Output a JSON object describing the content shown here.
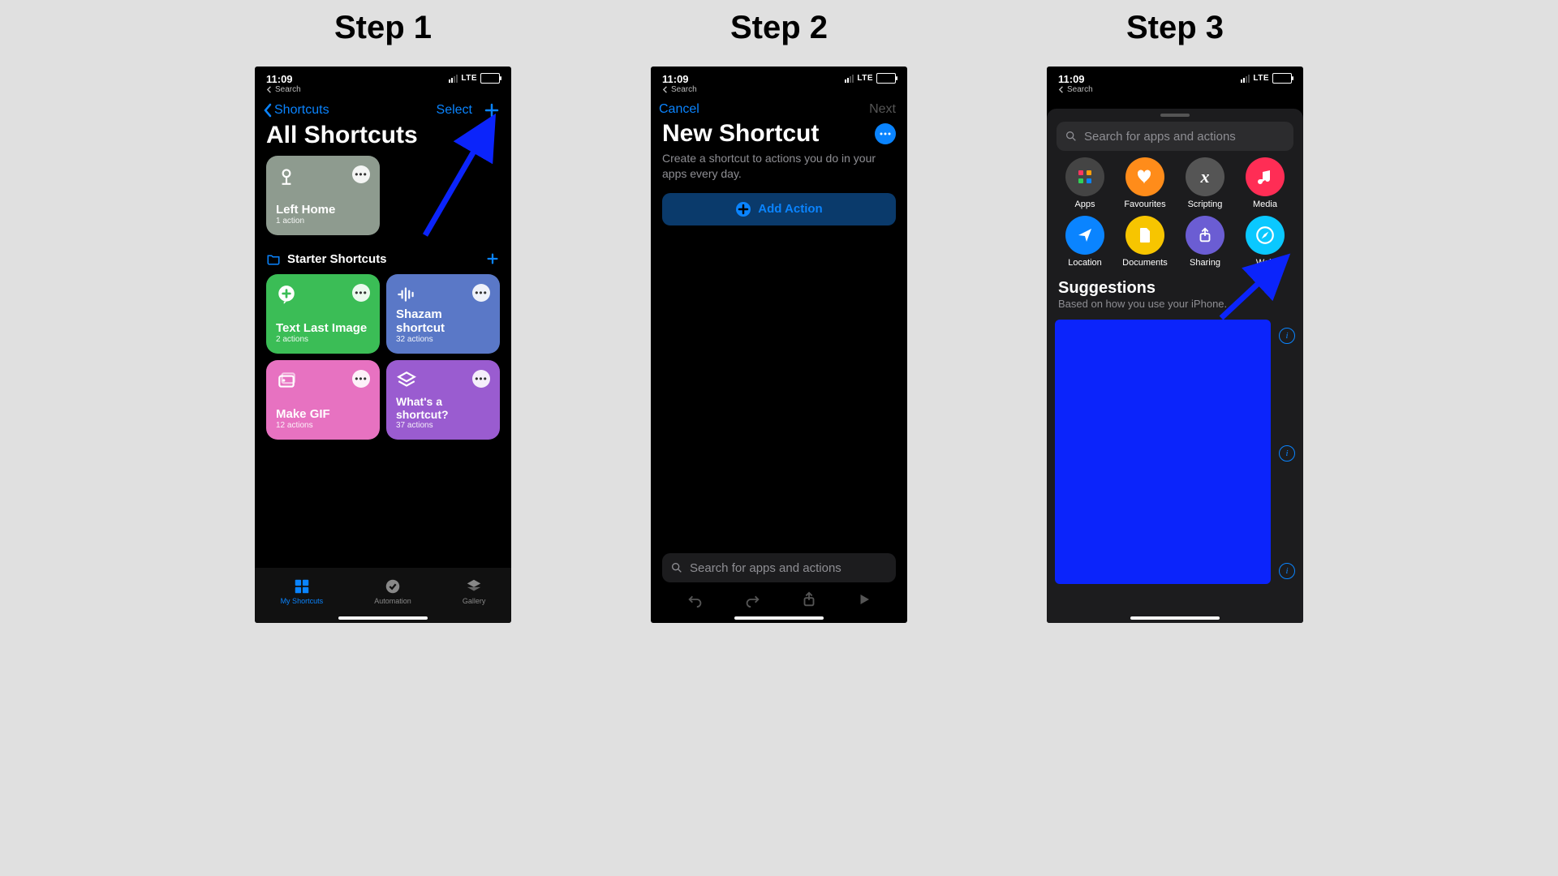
{
  "steps": {
    "s1": "Step 1",
    "s2": "Step 2",
    "s3": "Step 3"
  },
  "status": {
    "time": "11:09",
    "backSearch": "Search",
    "network": "LTE"
  },
  "p1": {
    "navBack": "Shortcuts",
    "navSelect": "Select",
    "title": "All Shortcuts",
    "leftHome": {
      "name": "Left Home",
      "sub": "1 action"
    },
    "sectionStarter": "Starter Shortcuts",
    "cards": {
      "textLast": {
        "name": "Text Last Image",
        "sub": "2 actions"
      },
      "shazam": {
        "name": "Shazam shortcut",
        "sub": "32 actions"
      },
      "makeGif": {
        "name": "Make GIF",
        "sub": "12 actions"
      },
      "whats": {
        "name": "What's a shortcut?",
        "sub": "37 actions"
      }
    },
    "tabs": {
      "my": "My Shortcuts",
      "auto": "Automation",
      "gallery": "Gallery"
    }
  },
  "p2": {
    "cancel": "Cancel",
    "next": "Next",
    "title": "New Shortcut",
    "desc": "Create a shortcut to actions you do in your apps every day.",
    "addAction": "Add Action",
    "searchPlaceholder": "Search for apps and actions"
  },
  "p3": {
    "searchPlaceholder": "Search for apps and actions",
    "cats": {
      "apps": "Apps",
      "fav": "Favourites",
      "script": "Scripting",
      "media": "Media",
      "loc": "Location",
      "docs": "Documents",
      "share": "Sharing",
      "web": "Web"
    },
    "suggTitle": "Suggestions",
    "suggSub": "Based on how you use your iPhone."
  }
}
